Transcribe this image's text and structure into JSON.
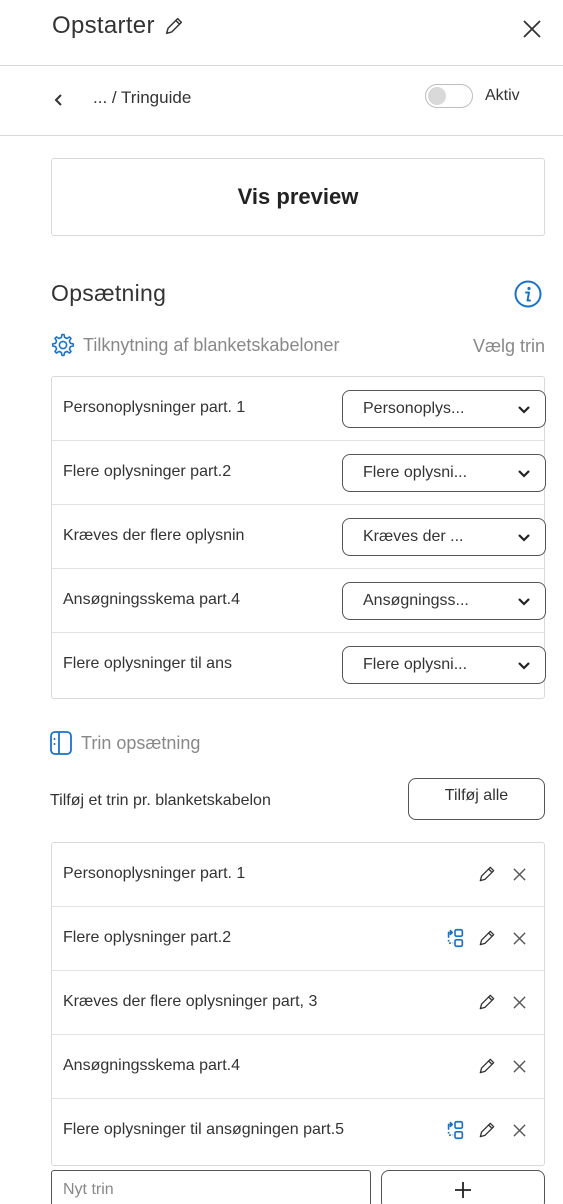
{
  "header": {
    "title": "Opstarter",
    "title_icon": "pencil-icon",
    "close_icon": "close-icon"
  },
  "nav": {
    "back_icon": "chevron-left-icon",
    "breadcrumb": "... / Tringuide",
    "toggle": {
      "label": "Aktiv",
      "on": false
    }
  },
  "preview_button": "Vis preview",
  "setup": {
    "title": "Opsætning",
    "info_icon": "info-icon",
    "mapping": {
      "heading": "Tilknytning af blanketskabeloner",
      "heading_icon": "gear-icon",
      "action": "Vælg trin",
      "rows": [
        {
          "label": "Personoplysninger part. 1",
          "selected": "Personoplys..."
        },
        {
          "label": "Flere oplysninger part.2",
          "selected": "Flere oplysni..."
        },
        {
          "label": "Kræves der flere oplysnin",
          "selected": "Kræves der ..."
        },
        {
          "label": "Ansøgningsskema part.4",
          "selected": "Ansøgningss..."
        },
        {
          "label": "Flere oplysninger til ans",
          "selected": "Flere oplysni..."
        }
      ]
    },
    "steps": {
      "heading": "Trin opsætning",
      "heading_icon": "panel-icon",
      "add_label": "Tilføj et trin pr. blanketskabelon",
      "add_all_button": "Tilføj alle",
      "rows": [
        {
          "label": "Personoplysninger part. 1",
          "has_branch": false
        },
        {
          "label": "Flere oplysninger part.2",
          "has_branch": true
        },
        {
          "label": "Kræves der flere oplysninger part, 3",
          "has_branch": false
        },
        {
          "label": "Ansøgningsskema part.4",
          "has_branch": false
        },
        {
          "label": "Flere oplysninger til ansøgningen part.5",
          "has_branch": true
        }
      ],
      "new_step_placeholder": "Nyt trin",
      "add_icon": "plus-icon"
    }
  },
  "colors": {
    "accent": "#1a73c8",
    "border": "#d9d9d9",
    "text": "#333333",
    "muted": "#888888"
  }
}
